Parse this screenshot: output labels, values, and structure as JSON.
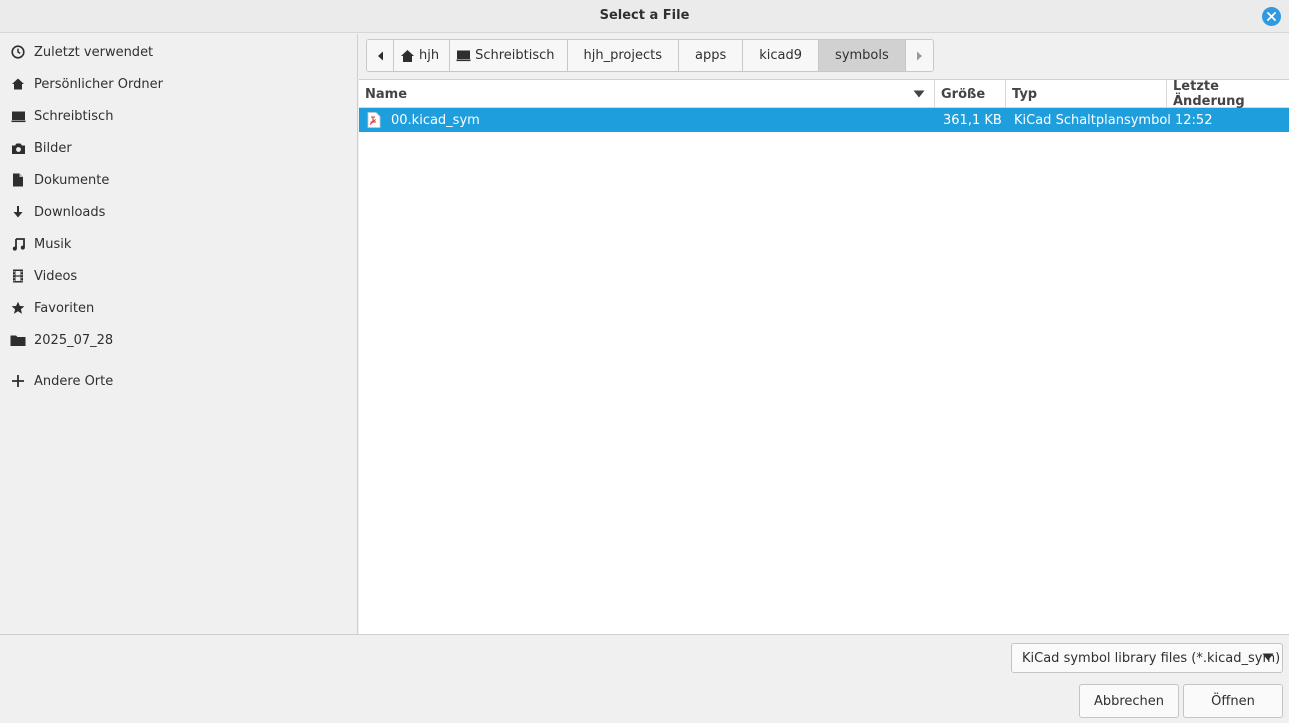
{
  "window": {
    "title": "Select a File"
  },
  "sidebar": {
    "items": [
      {
        "label": "Zuletzt verwendet",
        "icon": "clock-icon"
      },
      {
        "label": "Persönlicher Ordner",
        "icon": "home-icon"
      },
      {
        "label": "Schreibtisch",
        "icon": "desktop-icon"
      },
      {
        "label": "Bilder",
        "icon": "camera-icon"
      },
      {
        "label": "Dokumente",
        "icon": "document-icon"
      },
      {
        "label": "Downloads",
        "icon": "download-icon"
      },
      {
        "label": "Musik",
        "icon": "music-icon"
      },
      {
        "label": "Videos",
        "icon": "film-icon"
      },
      {
        "label": "Favoriten",
        "icon": "star-icon"
      },
      {
        "label": "2025_07_28",
        "icon": "folder-icon"
      }
    ],
    "other": {
      "label": "Andere Orte",
      "icon": "plus-icon"
    }
  },
  "path": {
    "segments": [
      "hjh",
      "Schreibtisch",
      "hjh_projects",
      "apps",
      "kicad9",
      "symbols"
    ],
    "active": "symbols"
  },
  "columns": {
    "name": "Name",
    "size": "Größe",
    "type": "Typ",
    "modified": "Letzte Änderung"
  },
  "files": [
    {
      "name": "00.kicad_sym",
      "size": "361,1 KB",
      "type": "KiCad Schaltplansymbol",
      "modified": "12:52",
      "selected": true
    }
  ],
  "filter": {
    "selected": "KiCad symbol library files (*.kicad_sym)"
  },
  "buttons": {
    "cancel": "Abbrechen",
    "open": "Öffnen"
  },
  "colors": {
    "selection": "#1f9ede",
    "close_button": "#2f9ae0"
  }
}
